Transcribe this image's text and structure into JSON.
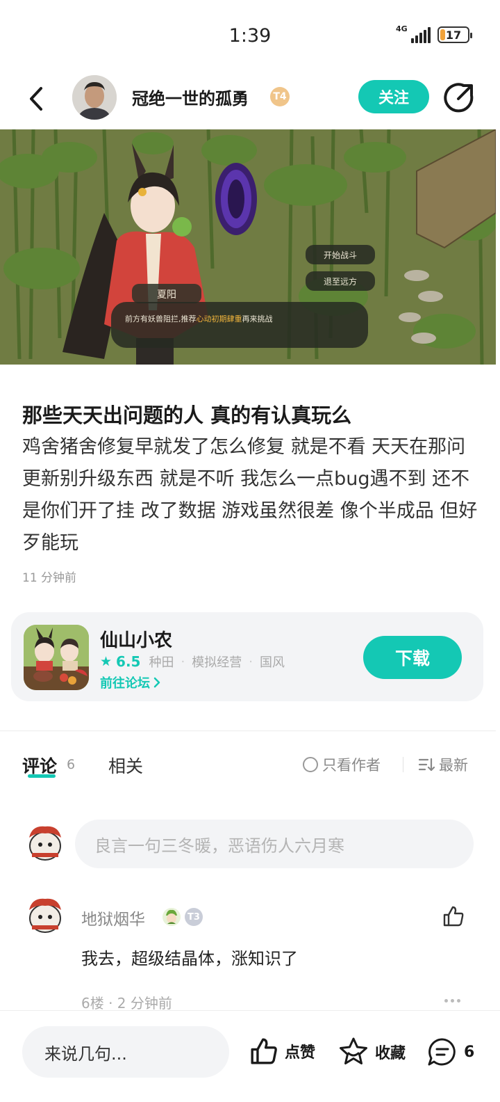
{
  "status_bar": {
    "time": "1:39",
    "network": "4G",
    "battery": "17",
    "battery_level": 0.17
  },
  "header": {
    "author_name": "冠绝一世的孤勇",
    "level_badge": "T4",
    "follow_label": "关注"
  },
  "banner": {
    "character_name": "夏阳",
    "dialog_text_before": "前方有妖兽阻拦,推荐",
    "dialog_text_highlight": "心动初期肆重",
    "dialog_text_after": "再来挑战",
    "option_fight": "开始战斗",
    "option_retreat": "退至远方"
  },
  "post": {
    "title": "那些天天出问题的人 真的有认真玩么",
    "body": "鸡舍猪舍修复早就发了怎么修复 就是不看 天天在那问  更新别升级东西 就是不听 我怎么一点bug遇不到  还不是你们开了挂  改了数据  游戏虽然很差 像个半成品 但好歹能玩",
    "time": "11 分钟前"
  },
  "game_card": {
    "name": "仙山小农",
    "rating": "6.5",
    "tags": [
      "种田",
      "模拟经营",
      "国风"
    ],
    "forum_link": "前往论坛",
    "download_label": "下载"
  },
  "tabs": {
    "comments_label": "评论",
    "comments_count": "6",
    "related_label": "相关",
    "only_author_label": "只看作者",
    "sort_label": "最新"
  },
  "comment_input": {
    "placeholder": "良言一句三冬暖，恶语伤人六月寒"
  },
  "comments": [
    {
      "user": "地狱烟华",
      "level": "T3",
      "text": "我去，超级结晶体，涨知识了",
      "meta": "6楼 · 2 分钟前"
    }
  ],
  "bottom_bar": {
    "reply_placeholder": "来说几句...",
    "like_label": "点赞",
    "favorite_label": "收藏",
    "comment_count": "6"
  },
  "colors": {
    "accent": "#14c8b4",
    "badge_gold": "#f0c58a",
    "battery": "#f2a33a"
  }
}
